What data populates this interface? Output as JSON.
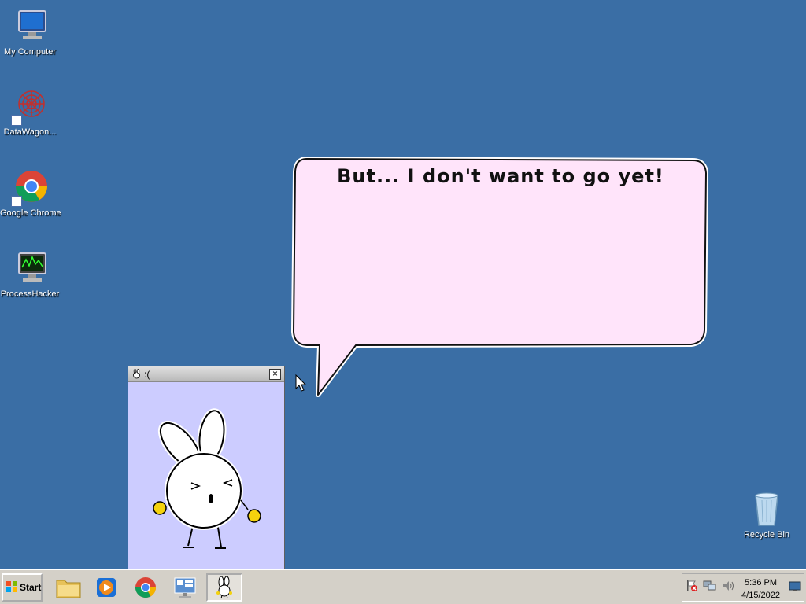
{
  "desktop": {
    "icons": [
      {
        "label": "My Computer",
        "icon": "computer-icon"
      },
      {
        "label": "DataWagon...",
        "icon": "datawagon-icon"
      },
      {
        "label": "Google Chrome",
        "icon": "chrome-icon"
      },
      {
        "label": "ProcessHacker",
        "icon": "processhacker-icon"
      }
    ],
    "recycle_bin": {
      "label": "Recycle Bin",
      "icon": "recycle-bin-icon"
    },
    "background_color": "#3a6ea5"
  },
  "speech_bubble": {
    "text": "But... I don't want to go yet!",
    "fill_color": "#ffe4fa",
    "border_color": "#111111"
  },
  "pet_window": {
    "title": ":(",
    "close_label": "×",
    "background_color": "#ccccff",
    "icon": "bunny-icon"
  },
  "taskbar": {
    "start_label": "Start",
    "pinned": [
      {
        "name": "file-explorer",
        "icon": "folder-icon"
      },
      {
        "name": "media-player",
        "icon": "media-player-icon"
      },
      {
        "name": "chrome",
        "icon": "chrome-icon"
      },
      {
        "name": "server-manager",
        "icon": "server-manager-icon"
      },
      {
        "name": "bunny-app",
        "icon": "bunny-icon",
        "active": true
      }
    ],
    "tray_icons": [
      "action-center-flag-icon",
      "network-icon",
      "volume-icon"
    ],
    "clock_time": "5:36 PM",
    "clock_date": "4/15/2022"
  }
}
